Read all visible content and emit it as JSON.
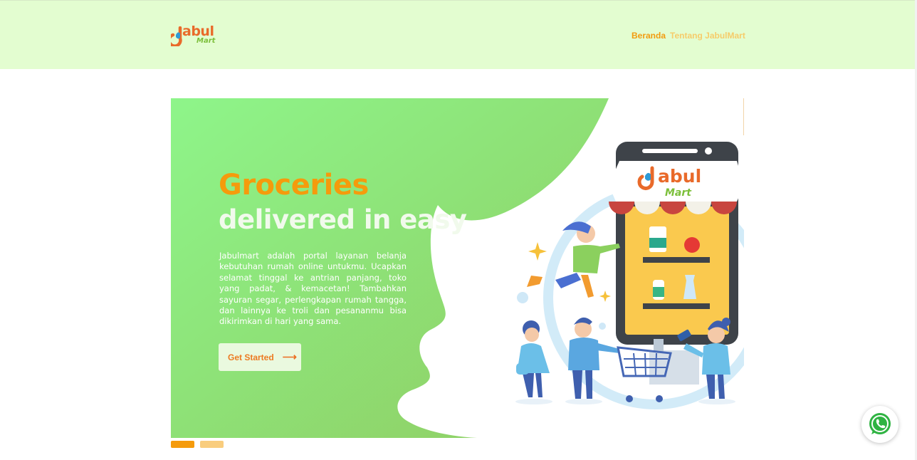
{
  "brand": {
    "name_main": "abul",
    "name_sub": "Mart",
    "logo_icon": "jabulmart-logo-icon"
  },
  "nav": {
    "items": [
      {
        "label": "Beranda",
        "active": true
      },
      {
        "label": "Tentang JabulMart",
        "active": false
      }
    ]
  },
  "hero": {
    "title": "Groceries",
    "subtitle": "delivered in easy",
    "description": "Jabulmart adalah portal layanan belanja kebutuhan rumah online untukmu. Ucapkan selamat tinggal ke antrian panjang, toko yang padat, & kemacetan! Tambahkan sayuran segar, perlengkapan rumah tangga, dan lainnya ke troli dan pesananmu bisa dikirimkan di hari yang sama.",
    "cta_label": "Get Started",
    "cta_icon": "arrow-right-icon",
    "illustration": "online-grocery-illustration",
    "phone_logo_main": "abul",
    "phone_logo_sub": "Mart"
  },
  "carousel": {
    "slides": 2,
    "active_index": 0
  },
  "whatsapp": {
    "icon": "whatsapp-icon"
  },
  "colors": {
    "nav_bg": "#e3fdd0",
    "accent_orange": "#f59b0c",
    "hero_green_start": "#8ef58a",
    "hero_green_end": "#94d06a",
    "whatsapp_green": "#2fb342"
  }
}
